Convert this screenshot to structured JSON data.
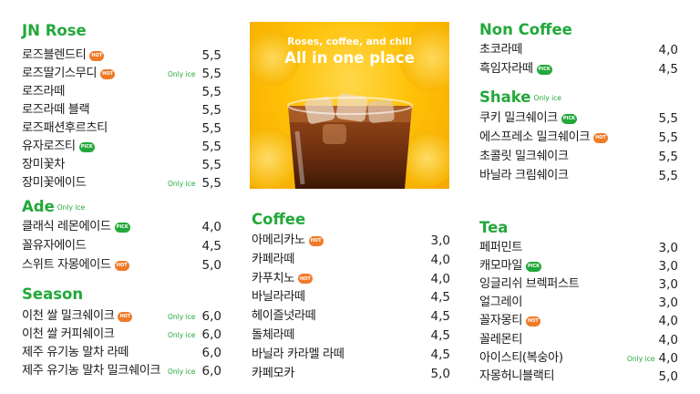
{
  "jn_rose": {
    "title": "JN Rose",
    "items": [
      {
        "name": "로즈블렌드티",
        "badge": "HOT",
        "note": "",
        "price": "5,5"
      },
      {
        "name": "로즈딸기스무디",
        "badge": "HOT",
        "note": "Only ice",
        "price": "5,5"
      },
      {
        "name": "로즈라떼",
        "badge": "",
        "note": "",
        "price": "5,5"
      },
      {
        "name": "로즈라떼 블랙",
        "badge": "",
        "note": "",
        "price": "5,5"
      },
      {
        "name": "로즈패션후르츠티",
        "badge": "",
        "note": "",
        "price": "5,5"
      },
      {
        "name": "유자로즈티",
        "badge": "PICK",
        "note": "",
        "price": "5,5"
      },
      {
        "name": "장미꽃차",
        "badge": "",
        "note": "",
        "price": "5,5"
      },
      {
        "name": "장미꽃에이드",
        "badge": "",
        "note": "Only ice",
        "price": "5,5"
      }
    ]
  },
  "ade": {
    "title": "Ade",
    "note": "Only ice",
    "items": [
      {
        "name": "클래식 레몬에이드",
        "badge": "PICK",
        "note": "",
        "price": "4,0"
      },
      {
        "name": "꼴유자에이드",
        "badge": "",
        "note": "",
        "price": "4,5"
      },
      {
        "name": "스위트 자몽에이드",
        "badge": "HOT",
        "note": "",
        "price": "5,0"
      }
    ]
  },
  "season": {
    "title": "Season",
    "items": [
      {
        "name": "이천 쌀 밀크쉐이크",
        "badge": "HOT",
        "note": "Only ice",
        "price": "6,0"
      },
      {
        "name": "이천 쌀 커피쉐이크",
        "badge": "",
        "note": "Only ice",
        "price": "6,0"
      },
      {
        "name": "제주 유기농 말차 라떼",
        "badge": "",
        "note": "",
        "price": "6,0"
      },
      {
        "name": "제주 유기농 말차 밀크쉐이크",
        "badge": "",
        "note": "Only ice",
        "price": "6,0"
      }
    ]
  },
  "hero": {
    "line1": "Roses, coffee, and chill",
    "line2": "All in one place"
  },
  "coffee": {
    "title": "Coffee",
    "items": [
      {
        "name": "아메리카노",
        "badge": "HOT",
        "note": "",
        "price": "3,0"
      },
      {
        "name": "카페라떼",
        "badge": "",
        "note": "",
        "price": "4,0"
      },
      {
        "name": "카푸치노",
        "badge": "HOT",
        "note": "",
        "price": "4,0"
      },
      {
        "name": "바닐라라떼",
        "badge": "",
        "note": "",
        "price": "4,5"
      },
      {
        "name": "헤이즐넛라떼",
        "badge": "",
        "note": "",
        "price": "4,5"
      },
      {
        "name": "돌체라떼",
        "badge": "",
        "note": "",
        "price": "4,5"
      },
      {
        "name": "바닐라 카라멜 라떼",
        "badge": "",
        "note": "",
        "price": "4,5"
      },
      {
        "name": "카페모카",
        "badge": "",
        "note": "",
        "price": "5,0"
      }
    ]
  },
  "non_coffee": {
    "title": "Non Coffee",
    "items": [
      {
        "name": "초코라떼",
        "badge": "",
        "note": "",
        "price": "4,0"
      },
      {
        "name": "흑임자라떼",
        "badge": "PICK",
        "note": "",
        "price": "4,5"
      }
    ]
  },
  "shake": {
    "title": "Shake",
    "note": "Only ice",
    "items": [
      {
        "name": "쿠키 밀크쉐이크",
        "badge": "PICK",
        "note": "",
        "price": "5,5"
      },
      {
        "name": "에스프레소 밀크쉐이크",
        "badge": "HOT",
        "note": "",
        "price": "5,5"
      },
      {
        "name": "초콜릿 밀크쉐이크",
        "badge": "",
        "note": "",
        "price": "5,5"
      },
      {
        "name": "바닐라 크림쉐이크",
        "badge": "",
        "note": "",
        "price": "5,5"
      }
    ]
  },
  "tea": {
    "title": "Tea",
    "items": [
      {
        "name": "페퍼민트",
        "badge": "",
        "note": "",
        "price": "3,0"
      },
      {
        "name": "캐모마일",
        "badge": "PICK",
        "note": "",
        "price": "3,0"
      },
      {
        "name": "잉글리쉬 브렉퍼스트",
        "badge": "",
        "note": "",
        "price": "3,0"
      },
      {
        "name": "얼그레이",
        "badge": "",
        "note": "",
        "price": "3,0"
      },
      {
        "name": "꼴자몽티",
        "badge": "HOT",
        "note": "",
        "price": "4,0"
      },
      {
        "name": "꼴레몬티",
        "badge": "",
        "note": "",
        "price": "4,0"
      },
      {
        "name": "아이스티(복숭아)",
        "badge": "",
        "note": "Only ice",
        "price": "4,0"
      },
      {
        "name": "자몽허니블랙티",
        "badge": "",
        "note": "",
        "price": "5,0"
      }
    ]
  },
  "colors": {
    "accent": "#22a83a",
    "hot_badge": "#f07a28",
    "pick_badge": "#22a83a",
    "hero_bg": "#ffc107"
  }
}
